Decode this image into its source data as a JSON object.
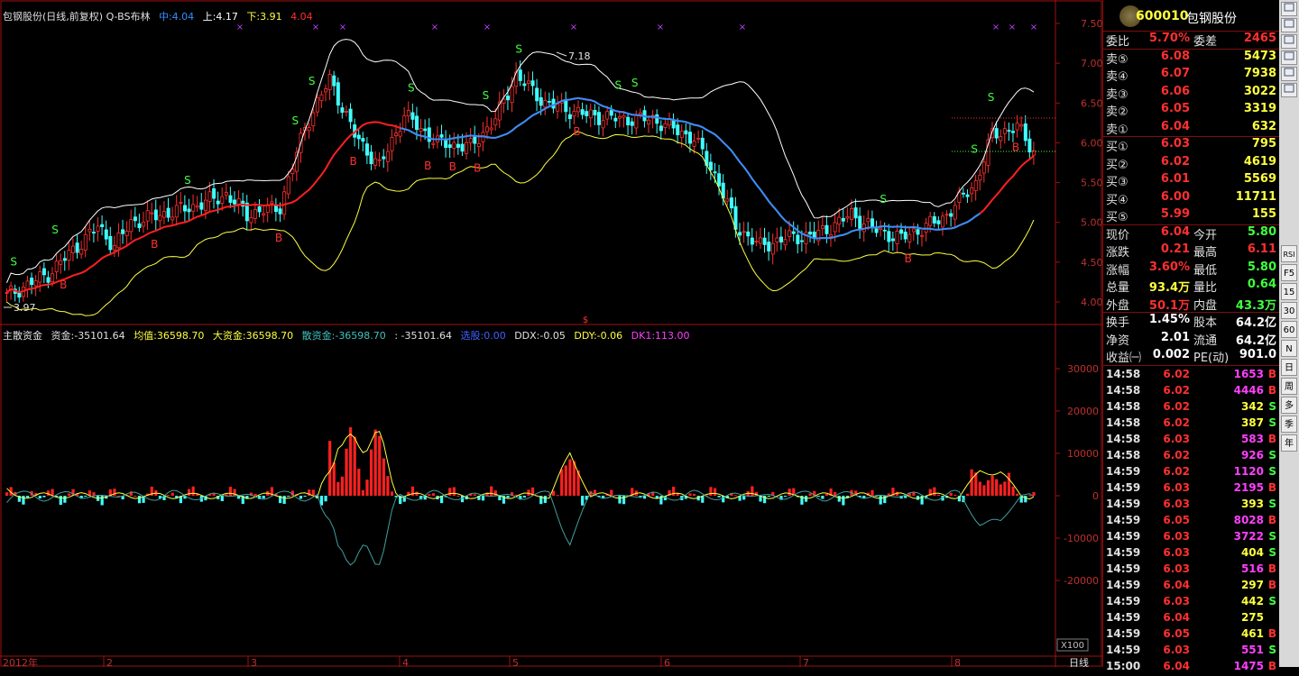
{
  "stock": {
    "code": "600010",
    "name": "包钢股份",
    "watermark": "包钢股份"
  },
  "upper_header": {
    "title": "包钢股份(日线,前复权) Q-BS布林",
    "mid_label": "中:",
    "mid": "4.04",
    "up_label": "上:",
    "up": "4.17",
    "down_label": "下:",
    "down": "3.91",
    "extra": "4.04"
  },
  "lower_header": {
    "name": "主散资金",
    "fund_label": "资金:",
    "fund": "-35101.64",
    "avg_label": "均值:",
    "avg": "36598.70",
    "big_label": "大资金:",
    "big": "36598.70",
    "retail_label": "散资金:",
    "retail": "-36598.70",
    "colon_val": ": -35101.64",
    "pick_label": "选股:",
    "pick": "0.00",
    "ddx_label": "DDX:",
    "ddx": "-0.05",
    "ddy_label": "DDY:",
    "ddy": "-0.06",
    "dk1_label": "DK1:",
    "dk1": "113.00"
  },
  "annotations": {
    "high_label": "7.18",
    "low_label": "3.97",
    "mid_marker": "$",
    "scale_tag": "X100"
  },
  "x_axis": {
    "year_label": "2012年",
    "months": [
      "2",
      "3",
      "4",
      "5",
      "6",
      "7",
      "8"
    ],
    "period_label": "日线"
  },
  "chart_data": [
    {
      "type": "candlestick",
      "title": "包钢股份(日线,前复权) Q-BS布林",
      "ylim": [
        3.8,
        7.6
      ],
      "yticks": [
        "7.50",
        "7.00",
        "6.50",
        "6.00",
        "5.50",
        "5.00",
        "4.50",
        "4.00"
      ],
      "series": [
        {
          "name": "中",
          "color": "#ff2020"
        },
        {
          "name": "上",
          "color": "#ffffff"
        },
        {
          "name": "下",
          "color": "#ffff40"
        }
      ],
      "signals": [
        "S",
        "B"
      ]
    },
    {
      "type": "bar",
      "title": "主散资金",
      "ylim": [
        -40000,
        40000
      ],
      "yticks": [
        "30000",
        "20000",
        "10000",
        "0",
        "-10000",
        "-20000"
      ],
      "series": [
        {
          "name": "大资金",
          "color": "#ffff40"
        },
        {
          "name": "散资金",
          "color": "#40c0c0"
        }
      ]
    }
  ],
  "quote": {
    "rows": [
      {
        "l1": "委比",
        "v1": "5.70%",
        "c1": "#ff3030",
        "l2": "委差",
        "v2": "2465",
        "c2": "#ff3030"
      },
      {
        "l1": "卖⑤",
        "v1": "6.08",
        "c1": "#ff3030",
        "l2": "",
        "v2": "5473",
        "c2": "#ffff40"
      },
      {
        "l1": "卖④",
        "v1": "6.07",
        "c1": "#ff3030",
        "l2": "",
        "v2": "7938",
        "c2": "#ffff40"
      },
      {
        "l1": "卖③",
        "v1": "6.06",
        "c1": "#ff3030",
        "l2": "",
        "v2": "3022",
        "c2": "#ffff40"
      },
      {
        "l1": "卖②",
        "v1": "6.05",
        "c1": "#ff3030",
        "l2": "",
        "v2": "3319",
        "c2": "#ffff40"
      },
      {
        "l1": "卖①",
        "v1": "6.04",
        "c1": "#ff3030",
        "l2": "",
        "v2": "632",
        "c2": "#ffff40"
      },
      {
        "l1": "买①",
        "v1": "6.03",
        "c1": "#ff3030",
        "l2": "",
        "v2": "795",
        "c2": "#ffff40"
      },
      {
        "l1": "买②",
        "v1": "6.02",
        "c1": "#ff3030",
        "l2": "",
        "v2": "4619",
        "c2": "#ffff40"
      },
      {
        "l1": "买③",
        "v1": "6.01",
        "c1": "#ff3030",
        "l2": "",
        "v2": "5569",
        "c2": "#ffff40"
      },
      {
        "l1": "买④",
        "v1": "6.00",
        "c1": "#ff3030",
        "l2": "",
        "v2": "11711",
        "c2": "#ffff40"
      },
      {
        "l1": "买⑤",
        "v1": "5.99",
        "c1": "#ff3030",
        "l2": "",
        "v2": "155",
        "c2": "#ffff40"
      },
      {
        "l1": "现价",
        "v1": "6.04",
        "c1": "#ff3030",
        "l2": "今开",
        "v2": "5.80",
        "c2": "#40ff40"
      },
      {
        "l1": "涨跌",
        "v1": "0.21",
        "c1": "#ff3030",
        "l2": "最高",
        "v2": "6.11",
        "c2": "#ff3030"
      },
      {
        "l1": "涨幅",
        "v1": "3.60%",
        "c1": "#ff3030",
        "l2": "最低",
        "v2": "5.80",
        "c2": "#40ff40"
      },
      {
        "l1": "总量",
        "v1": "93.4万",
        "c1": "#ffff40",
        "l2": "量比",
        "v2": "0.64",
        "c2": "#40ff40"
      },
      {
        "l1": "外盘",
        "v1": "50.1万",
        "c1": "#ff3030",
        "l2": "内盘",
        "v2": "43.3万",
        "c2": "#40ff40"
      },
      {
        "l1": "换手",
        "v1": "1.45%",
        "c1": "#ffffff",
        "l2": "股本",
        "v2": "64.2亿",
        "c2": "#ffffff"
      },
      {
        "l1": "净资",
        "v1": "2.01",
        "c1": "#ffffff",
        "l2": "流通",
        "v2": "64.2亿",
        "c2": "#ffffff"
      },
      {
        "l1": "收益㈠",
        "v1": "0.002",
        "c1": "#ffffff",
        "l2": "PE(动)",
        "v2": "901.0",
        "c2": "#ffffff"
      }
    ]
  },
  "ticks": [
    {
      "t": "14:58",
      "p": "6.02",
      "v": "1653",
      "s": "B",
      "vc": "#ff40ff"
    },
    {
      "t": "14:58",
      "p": "6.02",
      "v": "4446",
      "s": "B",
      "vc": "#ff40ff"
    },
    {
      "t": "14:58",
      "p": "6.02",
      "v": "342",
      "s": "S",
      "vc": "#ffff40"
    },
    {
      "t": "14:58",
      "p": "6.02",
      "v": "387",
      "s": "S",
      "vc": "#ffff40"
    },
    {
      "t": "14:58",
      "p": "6.03",
      "v": "583",
      "s": "B",
      "vc": "#ff40ff"
    },
    {
      "t": "14:58",
      "p": "6.02",
      "v": "926",
      "s": "S",
      "vc": "#ff40ff"
    },
    {
      "t": "14:59",
      "p": "6.02",
      "v": "1120",
      "s": "S",
      "vc": "#ff40ff"
    },
    {
      "t": "14:59",
      "p": "6.03",
      "v": "2195",
      "s": "B",
      "vc": "#ff40ff"
    },
    {
      "t": "14:59",
      "p": "6.03",
      "v": "393",
      "s": "S",
      "vc": "#ffff40"
    },
    {
      "t": "14:59",
      "p": "6.05",
      "v": "8028",
      "s": "B",
      "vc": "#ff40ff"
    },
    {
      "t": "14:59",
      "p": "6.03",
      "v": "3722",
      "s": "S",
      "vc": "#ff40ff"
    },
    {
      "t": "14:59",
      "p": "6.03",
      "v": "404",
      "s": "S",
      "vc": "#ffff40"
    },
    {
      "t": "14:59",
      "p": "6.03",
      "v": "516",
      "s": "B",
      "vc": "#ff40ff"
    },
    {
      "t": "14:59",
      "p": "6.04",
      "v": "297",
      "s": "B",
      "vc": "#ffff40"
    },
    {
      "t": "14:59",
      "p": "6.03",
      "v": "442",
      "s": "S",
      "vc": "#ffff40"
    },
    {
      "t": "14:59",
      "p": "6.04",
      "v": "275",
      "s": "",
      "vc": "#ffff40"
    },
    {
      "t": "14:59",
      "p": "6.05",
      "v": "461",
      "s": "B",
      "vc": "#ffff40"
    },
    {
      "t": "14:59",
      "p": "6.03",
      "v": "551",
      "s": "S",
      "vc": "#ff40ff"
    },
    {
      "t": "15:00",
      "p": "6.04",
      "v": "1475",
      "s": "B",
      "vc": "#ff40ff"
    }
  ],
  "toolbar": [
    "日",
    "周",
    "多",
    "季",
    "年",
    "F5",
    "15",
    "30",
    "60",
    "N",
    "RSI"
  ],
  "colors": {
    "up": "#ff3030",
    "down": "#40ffff",
    "mid_line_low": "#ff2020",
    "mid_line_high": "#3090ff",
    "grid_border": "#a01010",
    "axis_text": "#c03030"
  }
}
